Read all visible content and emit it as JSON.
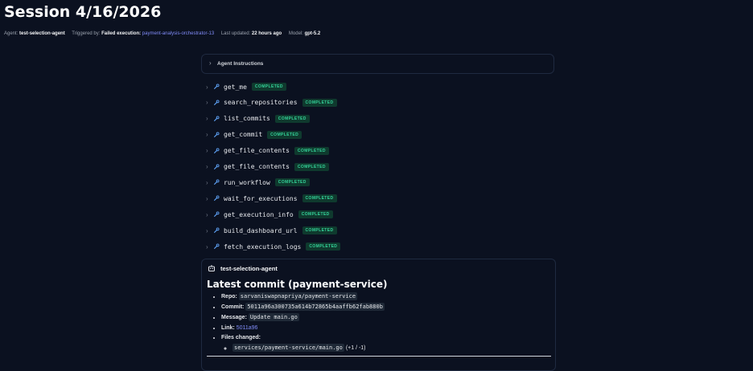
{
  "session": {
    "title": "Session 4/16/2026"
  },
  "meta": {
    "agent_label": "Agent:",
    "agent_value": "test-selection-agent",
    "triggered_label": "Triggered by:",
    "triggered_value": "Failed execution:",
    "triggered_link": "payment-analysis-orchestrator-13",
    "updated_label": "Last updated:",
    "updated_value": "22 hours ago",
    "model_label": "Model:",
    "model_value": "gpt-5.2"
  },
  "instructions": {
    "label": "Agent Instructions"
  },
  "tools": [
    {
      "name": "get_me",
      "status": "COMPLETED"
    },
    {
      "name": "search_repositories",
      "status": "COMPLETED"
    },
    {
      "name": "list_commits",
      "status": "COMPLETED"
    },
    {
      "name": "get_commit",
      "status": "COMPLETED"
    },
    {
      "name": "get_file_contents",
      "status": "COMPLETED"
    },
    {
      "name": "get_file_contents",
      "status": "COMPLETED"
    },
    {
      "name": "run_workflow",
      "status": "COMPLETED"
    },
    {
      "name": "wait_for_executions",
      "status": "COMPLETED"
    },
    {
      "name": "get_execution_info",
      "status": "COMPLETED"
    },
    {
      "name": "build_dashboard_url",
      "status": "COMPLETED"
    },
    {
      "name": "fetch_execution_logs",
      "status": "COMPLETED"
    }
  ],
  "message": {
    "agent_name": "test-selection-agent",
    "heading": "Latest commit (payment-service)",
    "repo_label": "Repo:",
    "repo_value": "sarvaniswapnapriya/payment-service",
    "commit_label": "Commit:",
    "commit_value": "5011a96a300735a614b72865b4aaffb62fab880b",
    "message_label": "Message:",
    "message_value": "Update main.go",
    "link_label": "Link:",
    "link_value": "5011a96",
    "files_label": "Files changed:",
    "file_path": "services/payment-service/main.go",
    "file_diff": "(+1 / -1)"
  },
  "colors": {
    "background": "#0b1120",
    "badge_bg": "#0f3a2e",
    "badge_text": "#34d399",
    "link": "#818cf8"
  }
}
